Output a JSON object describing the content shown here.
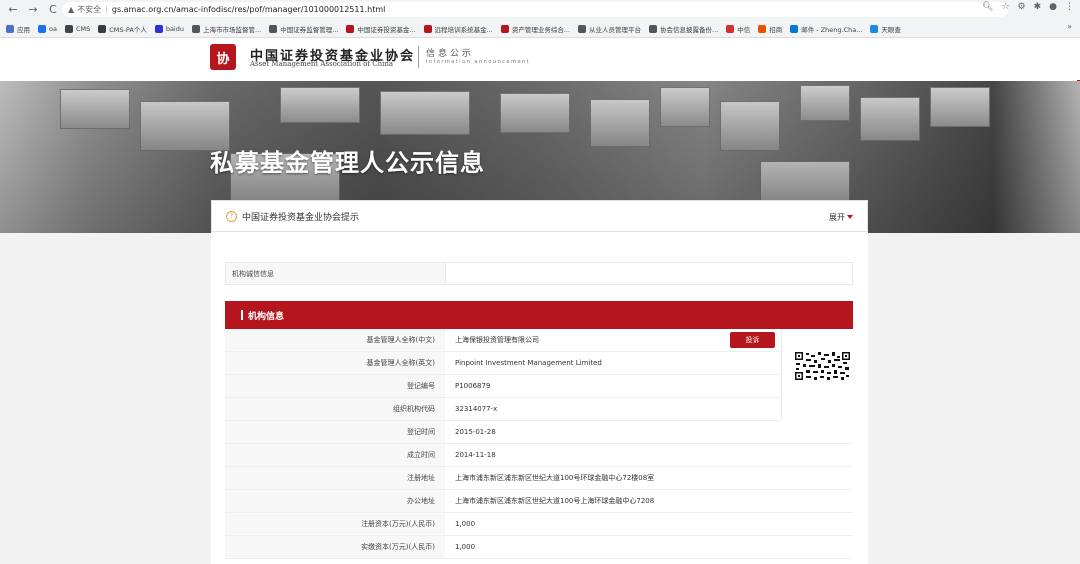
{
  "browser": {
    "back": "←",
    "forward": "→",
    "reload": "C",
    "insecure_label": "不安全",
    "url": "gs.amac.org.cn/amac-infodisc/res/pof/manager/101000012511.html",
    "bookmarks": [
      {
        "label": "应用",
        "color": "#4a72c4"
      },
      {
        "label": "oa",
        "color": "#1a73e8"
      },
      {
        "label": "CMS",
        "color": "#444444"
      },
      {
        "label": "CMS-PA个人",
        "color": "#3b3b3b"
      },
      {
        "label": "baidu",
        "color": "#2932e1"
      },
      {
        "label": "上海市市场监督管...",
        "color": "#555555"
      },
      {
        "label": "中国证券监督管理...",
        "color": "#555555"
      },
      {
        "label": "中国证券投资基金...",
        "color": "#b5161d"
      },
      {
        "label": "远程培训系统基金...",
        "color": "#b5161d"
      },
      {
        "label": "资产管理业务综合...",
        "color": "#b5161d"
      },
      {
        "label": "从业人员管理平台",
        "color": "#555555"
      },
      {
        "label": "协会信息披露备份...",
        "color": "#555555"
      },
      {
        "label": "中信",
        "color": "#d32f2f"
      },
      {
        "label": "招商",
        "color": "#e65100"
      },
      {
        "label": "邮件 - Zheng.Cha...",
        "color": "#0078d4"
      },
      {
        "label": "天眼查",
        "color": "#1e88e5"
      }
    ],
    "more": "»"
  },
  "header": {
    "logo_mark": "协",
    "org_cn": "中国证券投资基金业协会",
    "org_en": "Asset Management Association of China",
    "section_cn": "信息公示",
    "section_en": "information announcement"
  },
  "banner": {
    "title": "私募基金管理人公示信息"
  },
  "notice": {
    "icon": "?",
    "text": "中国证券投资基金业协会提示",
    "expand": "展开"
  },
  "credit": {
    "label": "机构诚信信息",
    "value": ""
  },
  "section": {
    "title": "机构信息"
  },
  "rows": [
    {
      "label": "基金管理人全称(中文)",
      "value": "上海保银投资管理有限公司"
    },
    {
      "label": "基金管理人全称(英文)",
      "value": "Pinpoint Investment Management Limited"
    },
    {
      "label": "登记编号",
      "value": "P1006879"
    },
    {
      "label": "组织机构代码",
      "value": "32314077-x"
    },
    {
      "label": "登记时间",
      "value": "2015-01-28"
    },
    {
      "label": "成立时间",
      "value": "2014-11-18"
    },
    {
      "label": "注册地址",
      "value": "上海市浦东新区浦东新区世纪大道100号环球金融中心72楼08室"
    },
    {
      "label": "办公地址",
      "value": "上海市浦东新区浦东新区世纪大道100号上海环球金融中心7208"
    },
    {
      "label": "注册资本(万元)(人民币)",
      "value": "1,000"
    },
    {
      "label": "实缴资本(万元)(人民币)",
      "value": "1,000"
    }
  ],
  "complain_label": "投诉",
  "colors": {
    "brand_red": "#b5161d",
    "notice_orange": "#e8a33b"
  }
}
